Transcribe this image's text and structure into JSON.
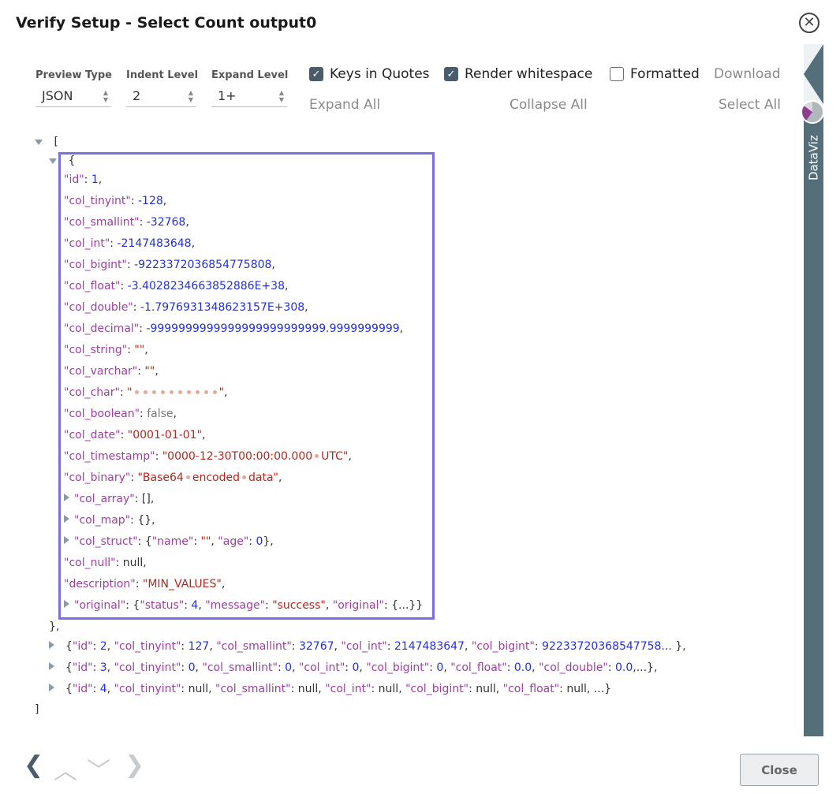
{
  "title": "Verify Setup - Select Count output0",
  "controls": {
    "preview_type": {
      "label": "Preview Type",
      "value": "JSON"
    },
    "indent_level": {
      "label": "Indent Level",
      "value": "2"
    },
    "expand_level": {
      "label": "Expand Level",
      "value": "1+"
    },
    "keys_in_quotes": {
      "label": "Keys in Quotes",
      "checked": true
    },
    "render_whitespace": {
      "label": "Render whitespace",
      "checked": true
    },
    "formatted": {
      "label": "Formatted",
      "checked": false
    },
    "download": "Download",
    "expand_all": "Expand All",
    "collapse_all": "Collapse All",
    "select_all": "Select All"
  },
  "side_panel": {
    "label": "DataViz"
  },
  "json": {
    "open_bracket": "[",
    "close_bracket": "]",
    "record1": {
      "open": "{",
      "close": "},",
      "fields": [
        {
          "key": "\"id\"",
          "value": "1",
          "type": "num"
        },
        {
          "key": "\"col_tinyint\"",
          "value": "-128",
          "type": "num"
        },
        {
          "key": "\"col_smallint\"",
          "value": "-32768",
          "type": "num"
        },
        {
          "key": "\"col_int\"",
          "value": "-2147483648",
          "type": "num"
        },
        {
          "key": "\"col_bigint\"",
          "value": "-9223372036854775808",
          "type": "num"
        },
        {
          "key": "\"col_float\"",
          "value": "-3.4028234663852886E+38",
          "type": "num"
        },
        {
          "key": "\"col_double\"",
          "value": "-1.7976931348623157E+308",
          "type": "num"
        },
        {
          "key": "\"col_decimal\"",
          "value": "-9999999999999999999999999.9999999999",
          "type": "num"
        },
        {
          "key": "\"col_string\"",
          "value": "\"\"",
          "type": "str"
        },
        {
          "key": "\"col_varchar\"",
          "value": "\"\"",
          "type": "str"
        },
        {
          "key": "\"col_char\"",
          "value": "\"          \"",
          "type": "str"
        },
        {
          "key": "\"col_boolean\"",
          "value": "false",
          "type": "bool"
        },
        {
          "key": "\"col_date\"",
          "value": "\"0001-01-01\"",
          "type": "str"
        },
        {
          "key": "\"col_timestamp\"",
          "value": "\"0000-12-30T00:00:00.000 UTC\"",
          "type": "str"
        },
        {
          "key": "\"col_binary\"",
          "value": "\"Base64 encoded data\"",
          "type": "str"
        },
        {
          "key": "\"col_array\"",
          "value": "[]",
          "type": "punct"
        },
        {
          "key": "\"col_map\"",
          "value": "{}",
          "type": "punct"
        },
        {
          "key": "\"col_struct\"",
          "value": "{\"name\": \"\", \"age\": 0}",
          "type": "struct"
        },
        {
          "key": "\"col_null\"",
          "value": "null",
          "type": "null"
        },
        {
          "key": "\"description\"",
          "value": "\"MIN_VALUES\"",
          "type": "str"
        },
        {
          "key": "\"original\"",
          "value": "{\"status\": 4, \"message\": \"success\", \"original\": {...}}",
          "type": "struct"
        }
      ]
    },
    "collapsed": [
      "{\"id\": 2, \"col_tinyint\": 127, \"col_smallint\": 32767, \"col_int\": 2147483647, \"col_bigint\": 92233720368547758... },",
      "{\"id\": 3, \"col_tinyint\": 0, \"col_smallint\": 0, \"col_int\": 0, \"col_bigint\": 0, \"col_float\": 0.0, \"col_double\": 0.0,...},",
      "{\"id\": 4, \"col_tinyint\": null, \"col_smallint\": null, \"col_int\": null, \"col_bigint\": null, \"col_float\": null, \"col_dou...}"
    ]
  },
  "footer": {
    "close_label": "Close"
  }
}
